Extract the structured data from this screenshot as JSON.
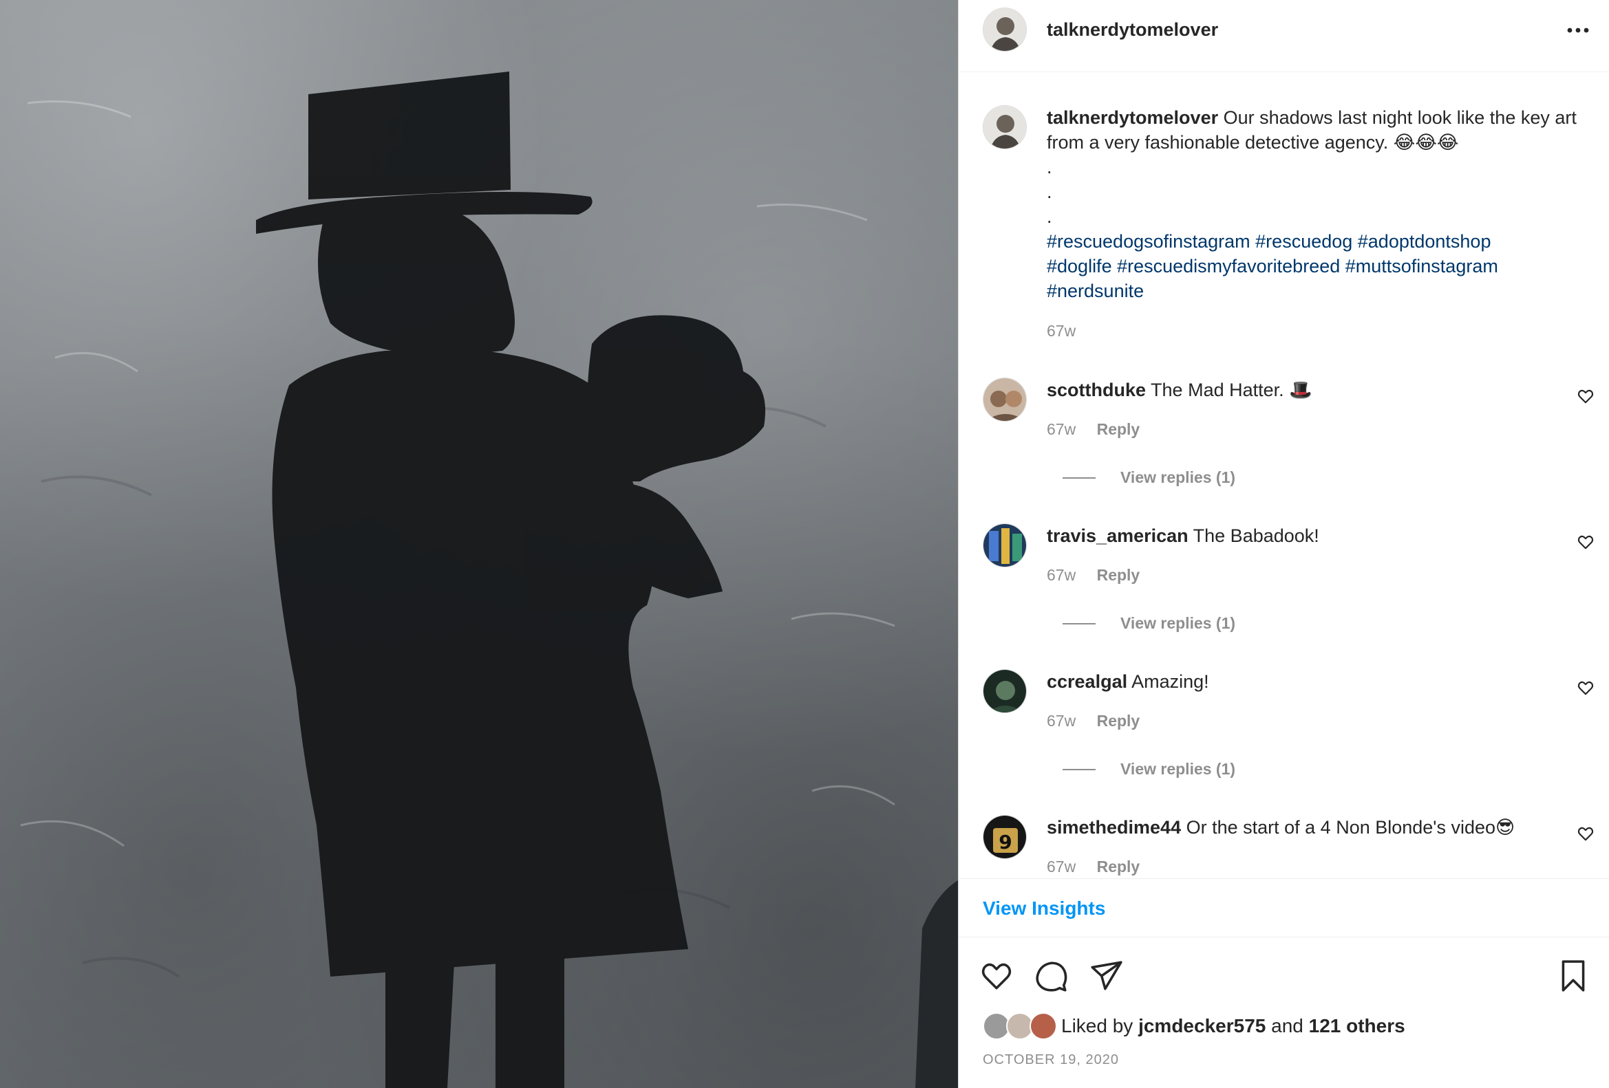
{
  "header": {
    "username": "talknerdytomelover",
    "more_icon": "more-horizontal-icon"
  },
  "caption": {
    "username": "talknerdytomelover",
    "text": "Our shadows last night look like the key art from a very fashionable detective agency. 😂😂😂",
    "dots": [
      ".",
      ".",
      "."
    ],
    "hashtags_line1": "#rescuedogsofinstagram #rescuedog #adoptdontshop",
    "hashtags_line2": "#doglife #rescuedismyfavoritebreed #muttsofinstagram",
    "hashtags_line3": "#nerdsunite",
    "time": "67w"
  },
  "comments": [
    {
      "username": "scotthduke",
      "text": "The Mad Hatter. 🎩",
      "time": "67w",
      "reply": "Reply",
      "view_replies": "View replies (1)"
    },
    {
      "username": "travis_american",
      "text": "The Babadook!",
      "time": "67w",
      "reply": "Reply",
      "view_replies": "View replies (1)"
    },
    {
      "username": "ccrealgal",
      "text": "Amazing!",
      "time": "67w",
      "reply": "Reply",
      "view_replies": "View replies (1)"
    },
    {
      "username": "simethedime44",
      "text": "Or the start of a 4 Non Blonde's video😎",
      "time": "67w",
      "reply": "Reply",
      "view_replies": ""
    }
  ],
  "insights": {
    "label": "View Insights"
  },
  "actions": {
    "like_icon": "heart-icon",
    "comment_icon": "comment-icon",
    "share_icon": "send-icon",
    "save_icon": "bookmark-icon"
  },
  "likes": {
    "prefix": "Liked by",
    "user": "jcmdecker575",
    "and": "and",
    "others": "121 others"
  },
  "date": "OCTOBER 19, 2020",
  "colors": {
    "link_blue": "#0095f6",
    "hashtag_blue": "#00376b",
    "muted": "#8e8e8e",
    "text": "#262626"
  }
}
